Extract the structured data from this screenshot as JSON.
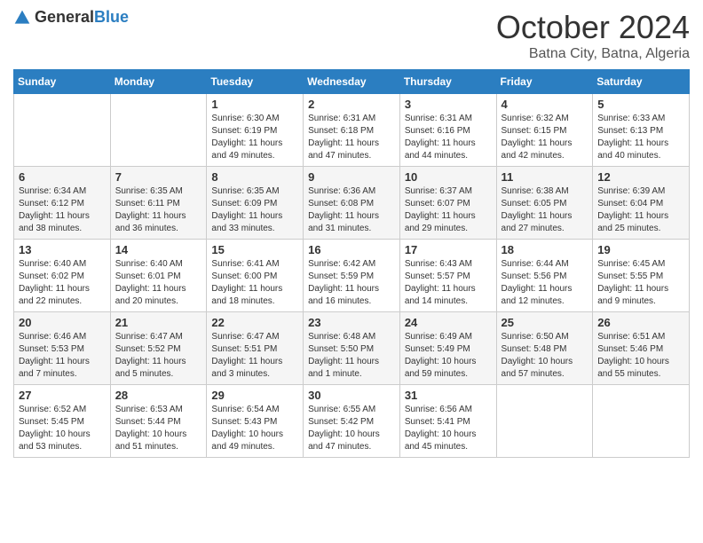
{
  "logo": {
    "text_general": "General",
    "text_blue": "Blue"
  },
  "header": {
    "month": "October 2024",
    "location": "Batna City, Batna, Algeria"
  },
  "weekdays": [
    "Sunday",
    "Monday",
    "Tuesday",
    "Wednesday",
    "Thursday",
    "Friday",
    "Saturday"
  ],
  "weeks": [
    [
      {
        "day": "",
        "sunrise": "",
        "sunset": "",
        "daylight": ""
      },
      {
        "day": "",
        "sunrise": "",
        "sunset": "",
        "daylight": ""
      },
      {
        "day": "1",
        "sunrise": "Sunrise: 6:30 AM",
        "sunset": "Sunset: 6:19 PM",
        "daylight": "Daylight: 11 hours and 49 minutes."
      },
      {
        "day": "2",
        "sunrise": "Sunrise: 6:31 AM",
        "sunset": "Sunset: 6:18 PM",
        "daylight": "Daylight: 11 hours and 47 minutes."
      },
      {
        "day": "3",
        "sunrise": "Sunrise: 6:31 AM",
        "sunset": "Sunset: 6:16 PM",
        "daylight": "Daylight: 11 hours and 44 minutes."
      },
      {
        "day": "4",
        "sunrise": "Sunrise: 6:32 AM",
        "sunset": "Sunset: 6:15 PM",
        "daylight": "Daylight: 11 hours and 42 minutes."
      },
      {
        "day": "5",
        "sunrise": "Sunrise: 6:33 AM",
        "sunset": "Sunset: 6:13 PM",
        "daylight": "Daylight: 11 hours and 40 minutes."
      }
    ],
    [
      {
        "day": "6",
        "sunrise": "Sunrise: 6:34 AM",
        "sunset": "Sunset: 6:12 PM",
        "daylight": "Daylight: 11 hours and 38 minutes."
      },
      {
        "day": "7",
        "sunrise": "Sunrise: 6:35 AM",
        "sunset": "Sunset: 6:11 PM",
        "daylight": "Daylight: 11 hours and 36 minutes."
      },
      {
        "day": "8",
        "sunrise": "Sunrise: 6:35 AM",
        "sunset": "Sunset: 6:09 PM",
        "daylight": "Daylight: 11 hours and 33 minutes."
      },
      {
        "day": "9",
        "sunrise": "Sunrise: 6:36 AM",
        "sunset": "Sunset: 6:08 PM",
        "daylight": "Daylight: 11 hours and 31 minutes."
      },
      {
        "day": "10",
        "sunrise": "Sunrise: 6:37 AM",
        "sunset": "Sunset: 6:07 PM",
        "daylight": "Daylight: 11 hours and 29 minutes."
      },
      {
        "day": "11",
        "sunrise": "Sunrise: 6:38 AM",
        "sunset": "Sunset: 6:05 PM",
        "daylight": "Daylight: 11 hours and 27 minutes."
      },
      {
        "day": "12",
        "sunrise": "Sunrise: 6:39 AM",
        "sunset": "Sunset: 6:04 PM",
        "daylight": "Daylight: 11 hours and 25 minutes."
      }
    ],
    [
      {
        "day": "13",
        "sunrise": "Sunrise: 6:40 AM",
        "sunset": "Sunset: 6:02 PM",
        "daylight": "Daylight: 11 hours and 22 minutes."
      },
      {
        "day": "14",
        "sunrise": "Sunrise: 6:40 AM",
        "sunset": "Sunset: 6:01 PM",
        "daylight": "Daylight: 11 hours and 20 minutes."
      },
      {
        "day": "15",
        "sunrise": "Sunrise: 6:41 AM",
        "sunset": "Sunset: 6:00 PM",
        "daylight": "Daylight: 11 hours and 18 minutes."
      },
      {
        "day": "16",
        "sunrise": "Sunrise: 6:42 AM",
        "sunset": "Sunset: 5:59 PM",
        "daylight": "Daylight: 11 hours and 16 minutes."
      },
      {
        "day": "17",
        "sunrise": "Sunrise: 6:43 AM",
        "sunset": "Sunset: 5:57 PM",
        "daylight": "Daylight: 11 hours and 14 minutes."
      },
      {
        "day": "18",
        "sunrise": "Sunrise: 6:44 AM",
        "sunset": "Sunset: 5:56 PM",
        "daylight": "Daylight: 11 hours and 12 minutes."
      },
      {
        "day": "19",
        "sunrise": "Sunrise: 6:45 AM",
        "sunset": "Sunset: 5:55 PM",
        "daylight": "Daylight: 11 hours and 9 minutes."
      }
    ],
    [
      {
        "day": "20",
        "sunrise": "Sunrise: 6:46 AM",
        "sunset": "Sunset: 5:53 PM",
        "daylight": "Daylight: 11 hours and 7 minutes."
      },
      {
        "day": "21",
        "sunrise": "Sunrise: 6:47 AM",
        "sunset": "Sunset: 5:52 PM",
        "daylight": "Daylight: 11 hours and 5 minutes."
      },
      {
        "day": "22",
        "sunrise": "Sunrise: 6:47 AM",
        "sunset": "Sunset: 5:51 PM",
        "daylight": "Daylight: 11 hours and 3 minutes."
      },
      {
        "day": "23",
        "sunrise": "Sunrise: 6:48 AM",
        "sunset": "Sunset: 5:50 PM",
        "daylight": "Daylight: 11 hours and 1 minute."
      },
      {
        "day": "24",
        "sunrise": "Sunrise: 6:49 AM",
        "sunset": "Sunset: 5:49 PM",
        "daylight": "Daylight: 10 hours and 59 minutes."
      },
      {
        "day": "25",
        "sunrise": "Sunrise: 6:50 AM",
        "sunset": "Sunset: 5:48 PM",
        "daylight": "Daylight: 10 hours and 57 minutes."
      },
      {
        "day": "26",
        "sunrise": "Sunrise: 6:51 AM",
        "sunset": "Sunset: 5:46 PM",
        "daylight": "Daylight: 10 hours and 55 minutes."
      }
    ],
    [
      {
        "day": "27",
        "sunrise": "Sunrise: 6:52 AM",
        "sunset": "Sunset: 5:45 PM",
        "daylight": "Daylight: 10 hours and 53 minutes."
      },
      {
        "day": "28",
        "sunrise": "Sunrise: 6:53 AM",
        "sunset": "Sunset: 5:44 PM",
        "daylight": "Daylight: 10 hours and 51 minutes."
      },
      {
        "day": "29",
        "sunrise": "Sunrise: 6:54 AM",
        "sunset": "Sunset: 5:43 PM",
        "daylight": "Daylight: 10 hours and 49 minutes."
      },
      {
        "day": "30",
        "sunrise": "Sunrise: 6:55 AM",
        "sunset": "Sunset: 5:42 PM",
        "daylight": "Daylight: 10 hours and 47 minutes."
      },
      {
        "day": "31",
        "sunrise": "Sunrise: 6:56 AM",
        "sunset": "Sunset: 5:41 PM",
        "daylight": "Daylight: 10 hours and 45 minutes."
      },
      {
        "day": "",
        "sunrise": "",
        "sunset": "",
        "daylight": ""
      },
      {
        "day": "",
        "sunrise": "",
        "sunset": "",
        "daylight": ""
      }
    ]
  ]
}
